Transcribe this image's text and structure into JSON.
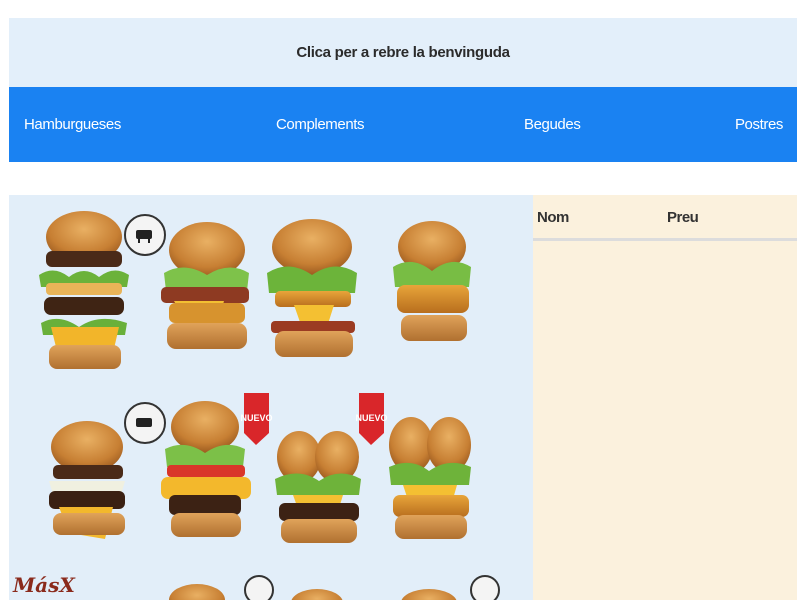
{
  "welcome": {
    "label": "Clica per a rebre la benvinguda"
  },
  "nav": {
    "items": [
      {
        "label": "Hamburgueses"
      },
      {
        "label": "Complements"
      },
      {
        "label": "Begudes"
      },
      {
        "label": "Postres"
      }
    ]
  },
  "order": {
    "columns": {
      "name": "Nom",
      "price": "Preu"
    }
  },
  "menu_image": {
    "badge_new": "NUEVO",
    "corner_logo": "MásX"
  },
  "colors": {
    "nav_bg": "#1a82f2",
    "welcome_bg": "#e3effa",
    "image_bg": "#e2eef9",
    "panel_bg": "#fbf1dd"
  }
}
